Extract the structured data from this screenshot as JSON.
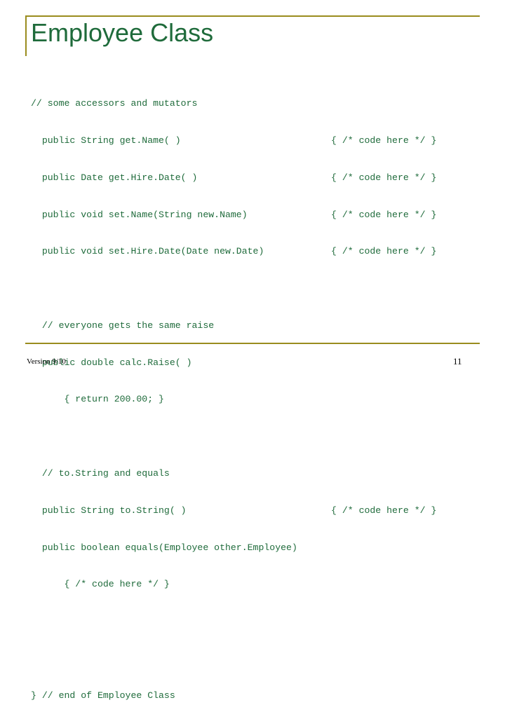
{
  "slide": {
    "title": "Employee Class",
    "accent_color": "#9a8c1e",
    "text_color": "#1f6b3b",
    "code_lines": [
      {
        "text": "// some accessors and mutators",
        "tail": ""
      },
      {
        "text": "  public String get.Name( )",
        "tail": "{ /* code here */ }"
      },
      {
        "text": "  public Date get.Hire.Date( )",
        "tail": "{ /* code here */ }"
      },
      {
        "text": "  public void set.Name(String new.Name)",
        "tail": "{ /* code here */ }"
      },
      {
        "text": "  public void set.Hire.Date(Date new.Date)",
        "tail": "{ /* code here */ }"
      },
      {
        "text": "",
        "tail": ""
      },
      {
        "text": "  // everyone gets the same raise",
        "tail": ""
      },
      {
        "text": "  public double calc.Raise( )",
        "tail": ""
      },
      {
        "text": "      { return 200.00; }",
        "tail": ""
      },
      {
        "text": "",
        "tail": ""
      },
      {
        "text": "  // to.String and equals",
        "tail": ""
      },
      {
        "text": "  public String to.String( )",
        "tail": "{ /* code here */ }"
      },
      {
        "text": "  public boolean equals(Employee other.Employee)",
        "tail": ""
      },
      {
        "text": "      { /* code here */ }",
        "tail": ""
      },
      {
        "text": "",
        "tail": ""
      },
      {
        "text": "} // end of Employee Class",
        "tail": ""
      }
    ],
    "footer": {
      "version": "Version 9/10",
      "page_number": "11"
    }
  }
}
